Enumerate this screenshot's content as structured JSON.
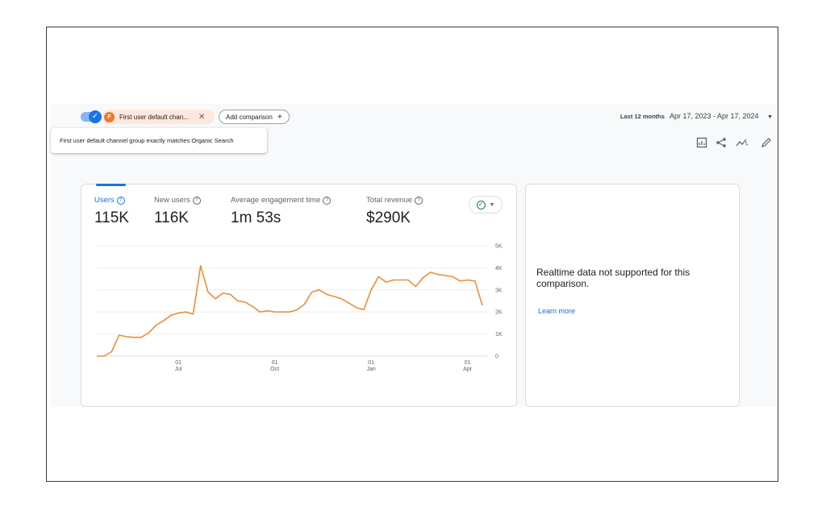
{
  "filter_bar": {
    "chip_letter": "F",
    "chip_label": "First user default chan...",
    "chip_close": "✕",
    "add_comparison": "Add comparison",
    "add_comparison_icon": "+",
    "date_preset": "Last 12 months",
    "date_range": "Apr 17, 2023 - Apr 17, 2024"
  },
  "tooltip": "First user default channel group exactly matches Organic Search",
  "toolbar": {
    "icons": [
      "customize-report-icon",
      "share-icon",
      "insights-icon",
      "edit-icon"
    ]
  },
  "metrics": [
    {
      "label": "Users",
      "value": "115K",
      "active": true
    },
    {
      "label": "New users",
      "value": "116K",
      "active": false
    },
    {
      "label": "Average engagement time",
      "value": "1m 53s",
      "active": false
    },
    {
      "label": "Total revenue",
      "value": "$290K",
      "active": false
    }
  ],
  "colors": {
    "accent": "#1a73e8",
    "series": "#ee8e3a",
    "chip_bg": "#fce8dc",
    "check": "#188038"
  },
  "chart_data": {
    "type": "line",
    "ylim": [
      0,
      5000
    ],
    "y_ticks": [
      0,
      1000,
      2000,
      3000,
      4000,
      5000
    ],
    "y_tick_labels": [
      "0",
      "1K",
      "2K",
      "3K",
      "4K",
      "5K"
    ],
    "x_ticks": [
      {
        "day": "01",
        "month": "Jul",
        "week_index": 11
      },
      {
        "day": "01",
        "month": "Oct",
        "week_index": 24
      },
      {
        "day": "01",
        "month": "Jan",
        "week_index": 37
      },
      {
        "day": "01",
        "month": "Apr",
        "week_index": 50
      }
    ],
    "grid": true,
    "series": [
      {
        "values": [
          0,
          0,
          200,
          950,
          880,
          850,
          850,
          1050,
          1400,
          1600,
          1850,
          1950,
          2000,
          1900,
          4100,
          2900,
          2600,
          2850,
          2800,
          2500,
          2450,
          2250,
          2000,
          2050,
          2000,
          2000,
          2000,
          2100,
          2350,
          2900,
          3000,
          2800,
          2700,
          2600,
          2400,
          2200,
          2100,
          3000,
          3600,
          3350,
          3450,
          3450,
          3450,
          3150,
          3550,
          3800,
          3700,
          3650,
          3600,
          3400,
          3450,
          3400,
          2300
        ]
      }
    ]
  },
  "realtime": {
    "message": "Realtime data not supported for this comparison.",
    "link": "Learn more"
  }
}
